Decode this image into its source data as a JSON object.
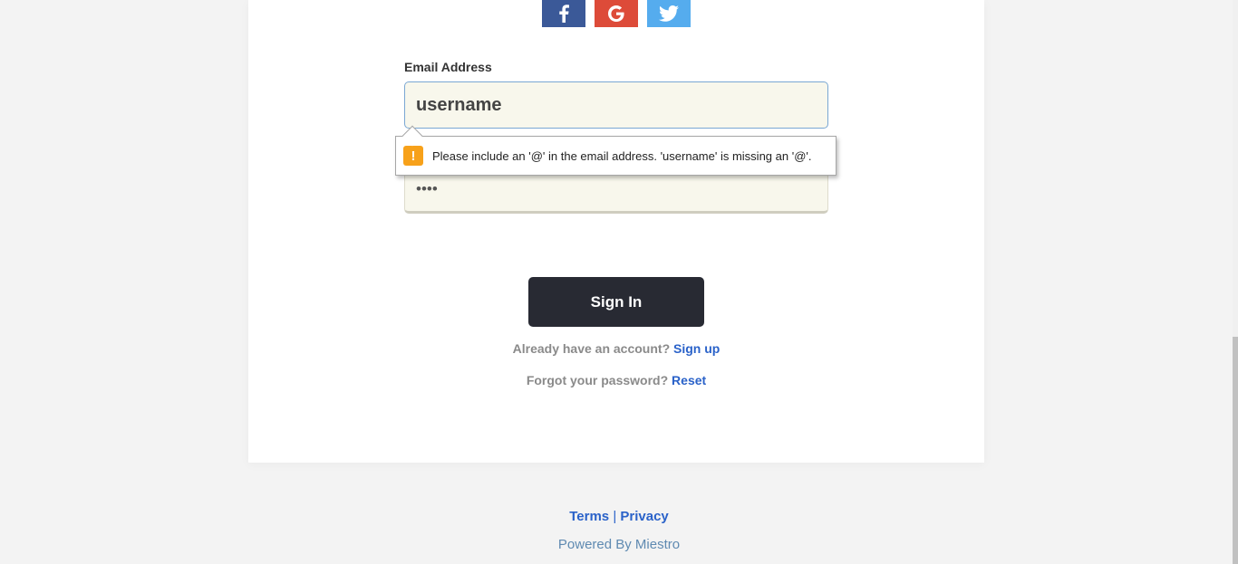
{
  "social": {
    "facebook": "facebook",
    "google": "google",
    "twitter": "twitter"
  },
  "form": {
    "email_label": "Email Address",
    "email_value": "username",
    "password_value": "••••"
  },
  "validation": {
    "message": "Please include an '@' in the email address. 'username' is missing an '@'.",
    "icon": "!"
  },
  "actions": {
    "signin_label": "Sign In",
    "account_prompt": "Already have an account?",
    "signup_link": "Sign up",
    "forgot_prompt": "Forgot your password?",
    "reset_link": "Reset"
  },
  "footer": {
    "terms": "Terms",
    "separator": "|",
    "privacy": "Privacy",
    "powered_by": "Powered By Miestro"
  },
  "colors": {
    "facebook": "#3b5998",
    "google": "#dd4b39",
    "twitter": "#55acee",
    "button": "#282a33",
    "link": "#2a62c9"
  }
}
